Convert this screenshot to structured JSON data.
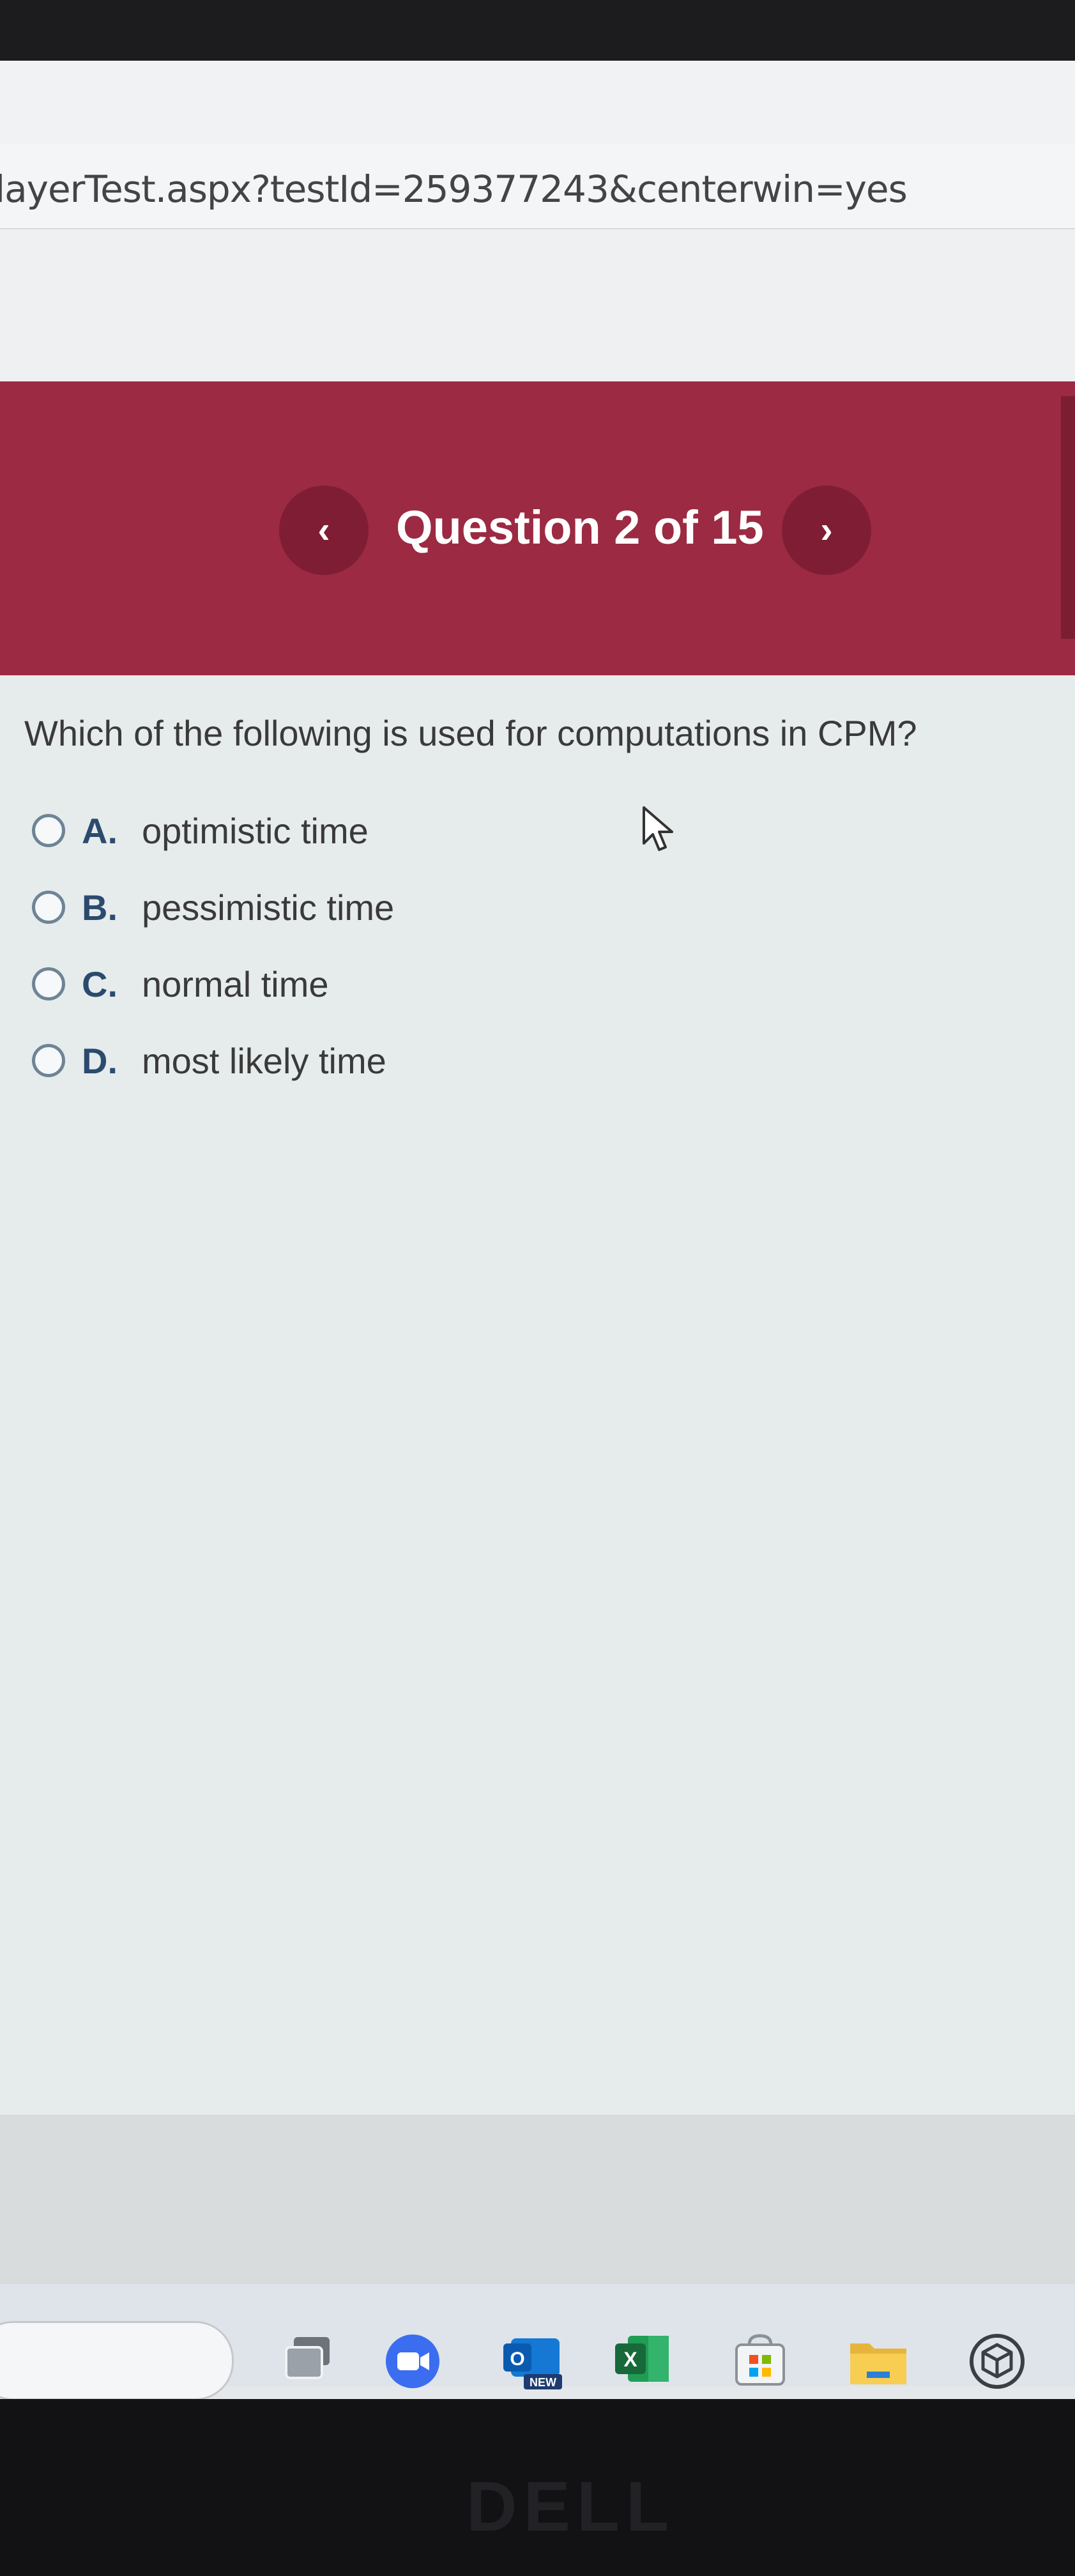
{
  "browser": {
    "url": "layerTest.aspx?testId=259377243&centerwin=yes"
  },
  "header": {
    "question_counter": "Question 2 of 15",
    "prev_button_glyph": "‹",
    "next_button_glyph": "›"
  },
  "question": {
    "text": "Which of the following is used for computations in CPM?",
    "options": [
      {
        "letter": "A.",
        "text": "optimistic time"
      },
      {
        "letter": "B.",
        "text": "pessimistic time"
      },
      {
        "letter": "C.",
        "text": "normal time"
      },
      {
        "letter": "D.",
        "text": "most likely time"
      }
    ]
  },
  "taskbar": {
    "apps": [
      "task-view-icon",
      "zoom-icon",
      "outlook-new-icon",
      "excel-icon",
      "microsoft-store-icon",
      "file-explorer-icon",
      "3d-box-icon"
    ],
    "outlook_badge": "NEW",
    "excel_glyph": "X"
  },
  "device": {
    "brand": "DELL"
  },
  "colors": {
    "banner": "#9b2a42",
    "nav_button": "#7f1d34",
    "option_letter": "#2b4b6e"
  }
}
